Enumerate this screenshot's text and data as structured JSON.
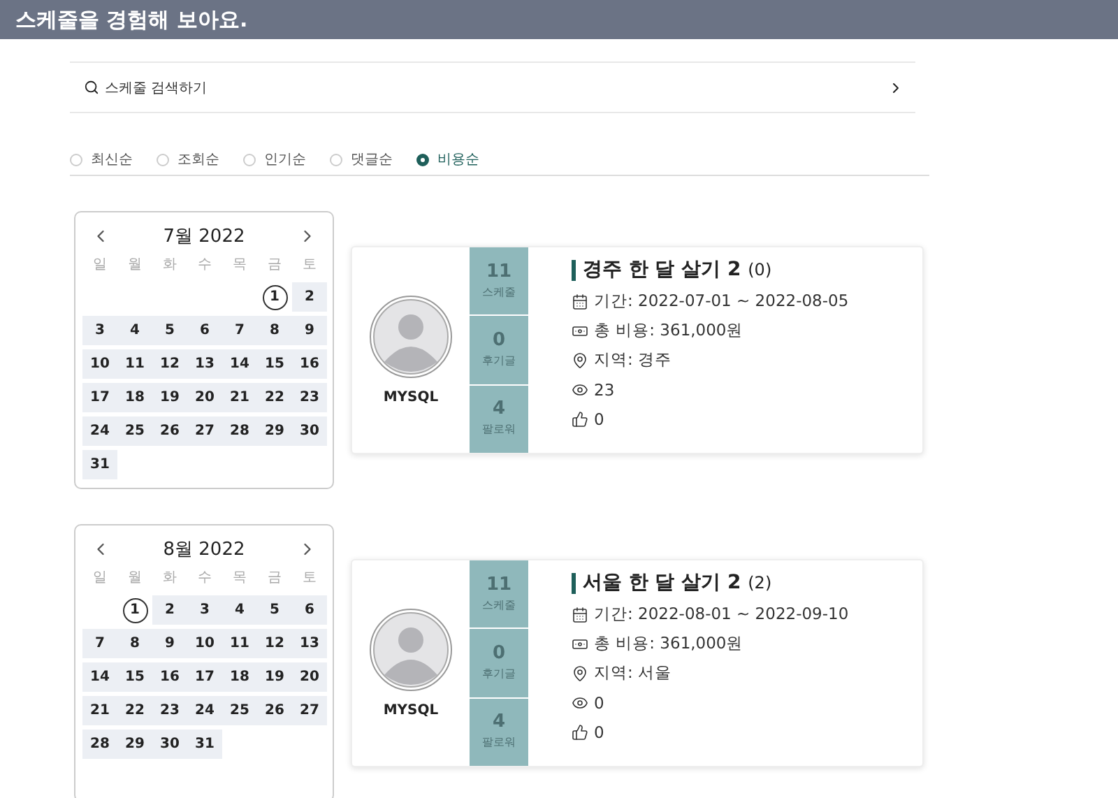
{
  "header": {
    "title": "스케줄을 경험해 보아요."
  },
  "search": {
    "placeholder": "스케줄 검색하기"
  },
  "sort_options": [
    {
      "label": "최신순",
      "selected": false
    },
    {
      "label": "조회순",
      "selected": false
    },
    {
      "label": "인기순",
      "selected": false
    },
    {
      "label": "댓글순",
      "selected": false
    },
    {
      "label": "비용순",
      "selected": true
    }
  ],
  "schedules": [
    {
      "calendar": {
        "title": "7월 2022",
        "weekdays": [
          "일",
          "월",
          "화",
          "수",
          "목",
          "금",
          "토"
        ],
        "weeks": [
          [
            {
              "kind": "blank"
            },
            {
              "kind": "blank"
            },
            {
              "kind": "blank"
            },
            {
              "kind": "blank"
            },
            {
              "kind": "blank"
            },
            {
              "kind": "day",
              "day": "1",
              "highlighted": false,
              "circled": true
            },
            {
              "kind": "day",
              "day": "2",
              "highlighted": true,
              "circled": false
            }
          ],
          [
            {
              "kind": "day",
              "day": "3",
              "highlighted": true,
              "circled": false
            },
            {
              "kind": "day",
              "day": "4",
              "highlighted": true,
              "circled": false
            },
            {
              "kind": "day",
              "day": "5",
              "highlighted": true,
              "circled": false
            },
            {
              "kind": "day",
              "day": "6",
              "highlighted": true,
              "circled": false
            },
            {
              "kind": "day",
              "day": "7",
              "highlighted": true,
              "circled": false
            },
            {
              "kind": "day",
              "day": "8",
              "highlighted": true,
              "circled": false
            },
            {
              "kind": "day",
              "day": "9",
              "highlighted": true,
              "circled": false
            }
          ],
          [
            {
              "kind": "day",
              "day": "10",
              "highlighted": true,
              "circled": false
            },
            {
              "kind": "day",
              "day": "11",
              "highlighted": true,
              "circled": false
            },
            {
              "kind": "day",
              "day": "12",
              "highlighted": true,
              "circled": false
            },
            {
              "kind": "day",
              "day": "13",
              "highlighted": true,
              "circled": false
            },
            {
              "kind": "day",
              "day": "14",
              "highlighted": true,
              "circled": false
            },
            {
              "kind": "day",
              "day": "15",
              "highlighted": true,
              "circled": false
            },
            {
              "kind": "day",
              "day": "16",
              "highlighted": true,
              "circled": false
            }
          ],
          [
            {
              "kind": "day",
              "day": "17",
              "highlighted": true,
              "circled": false
            },
            {
              "kind": "day",
              "day": "18",
              "highlighted": true,
              "circled": false
            },
            {
              "kind": "day",
              "day": "19",
              "highlighted": true,
              "circled": false
            },
            {
              "kind": "day",
              "day": "20",
              "highlighted": true,
              "circled": false
            },
            {
              "kind": "day",
              "day": "21",
              "highlighted": true,
              "circled": false
            },
            {
              "kind": "day",
              "day": "22",
              "highlighted": true,
              "circled": false
            },
            {
              "kind": "day",
              "day": "23",
              "highlighted": true,
              "circled": false
            }
          ],
          [
            {
              "kind": "day",
              "day": "24",
              "highlighted": true,
              "circled": false
            },
            {
              "kind": "day",
              "day": "25",
              "highlighted": true,
              "circled": false
            },
            {
              "kind": "day",
              "day": "26",
              "highlighted": true,
              "circled": false
            },
            {
              "kind": "day",
              "day": "27",
              "highlighted": true,
              "circled": false
            },
            {
              "kind": "day",
              "day": "28",
              "highlighted": true,
              "circled": false
            },
            {
              "kind": "day",
              "day": "29",
              "highlighted": true,
              "circled": false
            },
            {
              "kind": "day",
              "day": "30",
              "highlighted": true,
              "circled": false
            }
          ],
          [
            {
              "kind": "day",
              "day": "31",
              "highlighted": true,
              "circled": false
            }
          ]
        ]
      },
      "user": "MYSQL",
      "stats": [
        {
          "value": "11",
          "label": "스케줄"
        },
        {
          "value": "0",
          "label": "후기글"
        },
        {
          "value": "4",
          "label": "팔로워"
        }
      ],
      "title": "경주 한 달 살기 2",
      "comment_count": "(0)",
      "period": "기간: 2022-07-01 ~ 2022-08-05",
      "cost": "총 비용: 361,000원",
      "region": "지역: 경주",
      "views": "23",
      "likes": "0"
    },
    {
      "calendar": {
        "title": "8월 2022",
        "weekdays": [
          "일",
          "월",
          "화",
          "수",
          "목",
          "금",
          "토"
        ],
        "weeks": [
          [
            {
              "kind": "blank"
            },
            {
              "kind": "day",
              "day": "1",
              "highlighted": false,
              "circled": true
            },
            {
              "kind": "day",
              "day": "2",
              "highlighted": true,
              "circled": false
            },
            {
              "kind": "day",
              "day": "3",
              "highlighted": true,
              "circled": false
            },
            {
              "kind": "day",
              "day": "4",
              "highlighted": true,
              "circled": false
            },
            {
              "kind": "day",
              "day": "5",
              "highlighted": true,
              "circled": false
            },
            {
              "kind": "day",
              "day": "6",
              "highlighted": true,
              "circled": false
            }
          ],
          [
            {
              "kind": "day",
              "day": "7",
              "highlighted": true,
              "circled": false
            },
            {
              "kind": "day",
              "day": "8",
              "highlighted": true,
              "circled": false
            },
            {
              "kind": "day",
              "day": "9",
              "highlighted": true,
              "circled": false
            },
            {
              "kind": "day",
              "day": "10",
              "highlighted": true,
              "circled": false
            },
            {
              "kind": "day",
              "day": "11",
              "highlighted": true,
              "circled": false
            },
            {
              "kind": "day",
              "day": "12",
              "highlighted": true,
              "circled": false
            },
            {
              "kind": "day",
              "day": "13",
              "highlighted": true,
              "circled": false
            }
          ],
          [
            {
              "kind": "day",
              "day": "14",
              "highlighted": true,
              "circled": false
            },
            {
              "kind": "day",
              "day": "15",
              "highlighted": true,
              "circled": false
            },
            {
              "kind": "day",
              "day": "16",
              "highlighted": true,
              "circled": false
            },
            {
              "kind": "day",
              "day": "17",
              "highlighted": true,
              "circled": false
            },
            {
              "kind": "day",
              "day": "18",
              "highlighted": true,
              "circled": false
            },
            {
              "kind": "day",
              "day": "19",
              "highlighted": true,
              "circled": false
            },
            {
              "kind": "day",
              "day": "20",
              "highlighted": true,
              "circled": false
            }
          ],
          [
            {
              "kind": "day",
              "day": "21",
              "highlighted": true,
              "circled": false
            },
            {
              "kind": "day",
              "day": "22",
              "highlighted": true,
              "circled": false
            },
            {
              "kind": "day",
              "day": "23",
              "highlighted": true,
              "circled": false
            },
            {
              "kind": "day",
              "day": "24",
              "highlighted": true,
              "circled": false
            },
            {
              "kind": "day",
              "day": "25",
              "highlighted": true,
              "circled": false
            },
            {
              "kind": "day",
              "day": "26",
              "highlighted": true,
              "circled": false
            },
            {
              "kind": "day",
              "day": "27",
              "highlighted": true,
              "circled": false
            }
          ],
          [
            {
              "kind": "day",
              "day": "28",
              "highlighted": true,
              "circled": false
            },
            {
              "kind": "day",
              "day": "29",
              "highlighted": true,
              "circled": false
            },
            {
              "kind": "day",
              "day": "30",
              "highlighted": true,
              "circled": false
            },
            {
              "kind": "day",
              "day": "31",
              "highlighted": true,
              "circled": false
            }
          ]
        ]
      },
      "user": "MYSQL",
      "stats": [
        {
          "value": "11",
          "label": "스케줄"
        },
        {
          "value": "0",
          "label": "후기글"
        },
        {
          "value": "4",
          "label": "팔로워"
        }
      ],
      "title": "서울 한 달 살기 2",
      "comment_count": "(2)",
      "period": "기간: 2022-08-01 ~ 2022-09-10",
      "cost": "총 비용: 361,000원",
      "region": "지역: 서울",
      "views": "0",
      "likes": "0"
    }
  ]
}
